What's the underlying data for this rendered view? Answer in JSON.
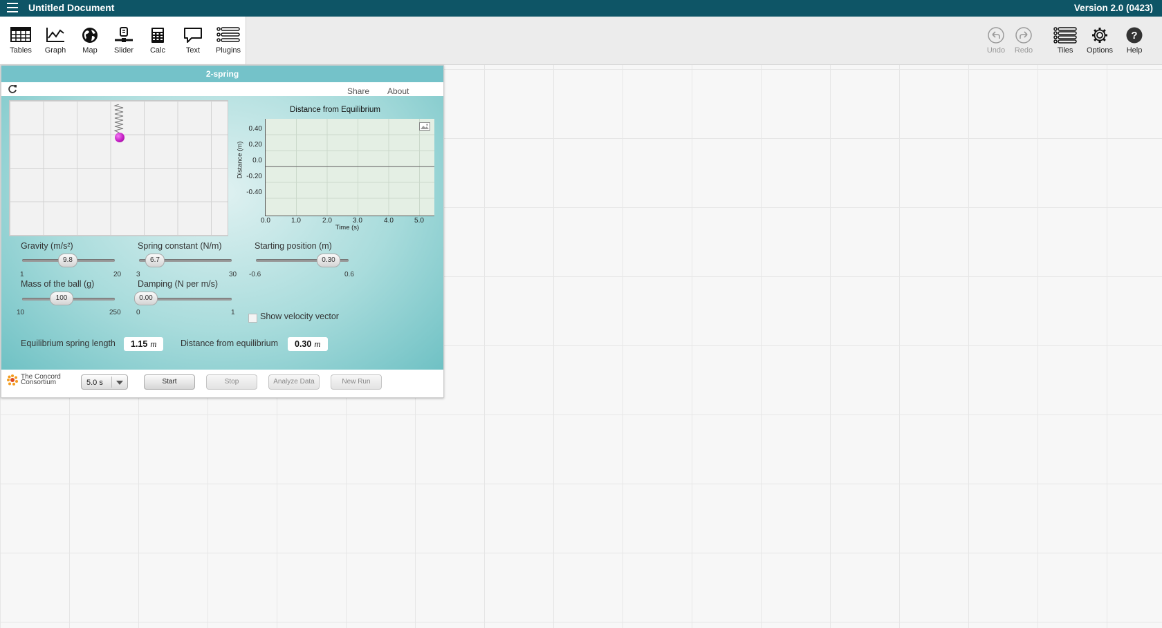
{
  "app": {
    "title": "Untitled Document",
    "version": "Version 2.0 (0423)"
  },
  "toolshelf": {
    "tools": [
      {
        "label": "Tables",
        "icon": "table-icon"
      },
      {
        "label": "Graph",
        "icon": "graph-icon"
      },
      {
        "label": "Map",
        "icon": "globe-icon"
      },
      {
        "label": "Slider",
        "icon": "slider-icon"
      },
      {
        "label": "Calc",
        "icon": "calculator-icon"
      },
      {
        "label": "Text",
        "icon": "speech-bubble-icon"
      },
      {
        "label": "Plugins",
        "icon": "plugins-icon"
      }
    ],
    "right": [
      {
        "label": "Undo",
        "icon": "undo-icon",
        "enabled": false
      },
      {
        "label": "Redo",
        "icon": "redo-icon",
        "enabled": false
      },
      {
        "label": "Tiles",
        "icon": "tiles-icon",
        "enabled": true
      },
      {
        "label": "Options",
        "icon": "gear-icon",
        "enabled": true
      },
      {
        "label": "Help",
        "icon": "help-icon",
        "enabled": true
      }
    ]
  },
  "component": {
    "title": "2-spring",
    "share_label": "Share",
    "about_label": "About",
    "graph": {
      "title": "Distance from Equilibrium",
      "ylabel": "Distance (m)",
      "xlabel": "Time (s)",
      "yticks": [
        "0.40",
        "0.20",
        "0.0",
        "-0.20",
        "-0.40"
      ],
      "xticks": [
        "0.0",
        "1.0",
        "2.0",
        "3.0",
        "4.0",
        "5.0"
      ]
    },
    "sliders": {
      "gravity": {
        "label": "Gravity (m/s²)",
        "value": "9.8",
        "min": "1",
        "max": "20"
      },
      "spring_constant": {
        "label": "Spring constant (N/m)",
        "value": "6.7",
        "min": "3",
        "max": "30"
      },
      "starting_position": {
        "label": "Starting position (m)",
        "value": "0.30",
        "min": "-0.6",
        "max": "0.6"
      },
      "mass": {
        "label": "Mass of the ball (g)",
        "value": "100",
        "min": "10",
        "max": "250"
      },
      "damping": {
        "label": "Damping (N per m/s)",
        "value": "0.00",
        "min": "0",
        "max": "1"
      }
    },
    "show_velocity_label": "Show velocity vector",
    "readouts": {
      "eq_length": {
        "label": "Equilibrium spring length",
        "value": "1.15",
        "unit": "m"
      },
      "distance": {
        "label": "Distance from equilibrium",
        "value": "0.30",
        "unit": "m"
      }
    },
    "footer": {
      "logo_line1": "The Concord",
      "logo_line2": "Consortium",
      "duration": "5.0 s",
      "start": "Start",
      "stop": "Stop",
      "analyze": "Analyze Data",
      "new_run": "New Run"
    }
  },
  "colors": {
    "topbar": "#0e5566",
    "tile_title": "#74c2c9",
    "ball": "#c41ec4"
  }
}
